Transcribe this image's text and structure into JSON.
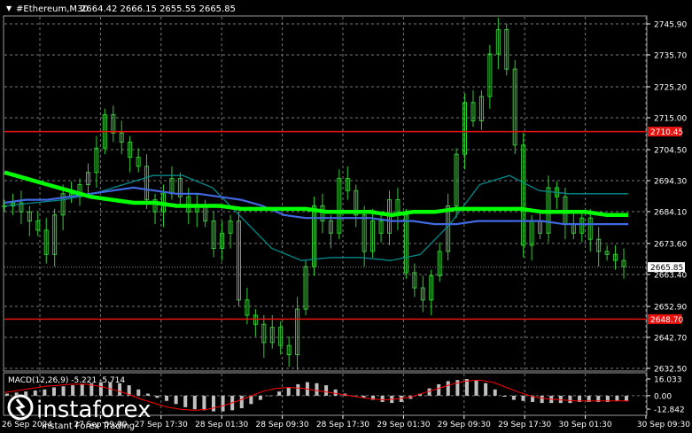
{
  "header": {
    "symbol": "#Ethereum,M30",
    "ohlc": "2664.42 2666.15 2655.55 2665.85"
  },
  "price_axis_ticks": [
    "2745.90",
    "2735.70",
    "2725.20",
    "2715.00",
    "2704.50",
    "2694.30",
    "2684.10",
    "2673.60",
    "2663.40",
    "2652.90",
    "2642.70",
    "2632.50"
  ],
  "time_axis_ticks": [
    "26 Sep 2024",
    "27 Sep 09:00",
    "27 Sep 17:30",
    "28 Sep 01:30",
    "28 Sep 09:30",
    "28 Sep 17:30",
    "29 Sep 01:30",
    "29 Sep 09:30",
    "29 Sep 17:30",
    "30 Sep 01:30",
    "30 Sep 09:30"
  ],
  "levels": {
    "resistance": {
      "value": 2710.45,
      "label": "2710.45",
      "color": "#e8130f"
    },
    "support": {
      "value": 2648.7,
      "label": "2648.70",
      "color": "#e8130f"
    },
    "current": {
      "value": 2665.85,
      "label": "2665.85"
    }
  },
  "macd": {
    "label": "MACD(12,26,9) -5.221 -5.714",
    "ticks": [
      "16.033",
      "0.00",
      "-12.842"
    ]
  },
  "watermark": {
    "brand": "instaforex",
    "tagline": "Instant Forex Trading"
  },
  "colors": {
    "candles": "#32cd32",
    "ma_slow": "#00ff00",
    "ma_mid": "#4169e1",
    "ma_fast": "#008b8b",
    "macd_hist": "#c0c0c0",
    "macd_signal": "#ff0000",
    "levels": "#e8130f"
  },
  "chart_data": {
    "type": "candlestick",
    "symbol": "#Ethereum",
    "timeframe": "M30",
    "y_axis": {
      "min": 2632.5,
      "max": 2745.9
    },
    "close_series": [
      2686,
      2687,
      2684,
      2681,
      2678,
      2670,
      2683,
      2690,
      2689,
      2693,
      2697,
      2705,
      2716,
      2710,
      2707,
      2702,
      2699,
      2688,
      2684,
      2690,
      2695,
      2689,
      2684,
      2686,
      2681,
      2672,
      2677,
      2681,
      2655,
      2650,
      2647,
      2641,
      2646,
      2640,
      2637,
      2652,
      2666,
      2686,
      2681,
      2677,
      2695,
      2691,
      2683,
      2671,
      2681,
      2677,
      2688,
      2683,
      2664,
      2659,
      2655,
      2663,
      2671,
      2686,
      2703,
      2720,
      2714,
      2722,
      2736,
      2744,
      2731,
      2706,
      2673,
      2681,
      2677,
      2692,
      2689,
      2680,
      2677,
      2682,
      2675,
      2671,
      2670,
      2668,
      2666
    ],
    "ma_slow_series": [
      2697,
      2695,
      2693,
      2691,
      2689,
      2688,
      2687,
      2687,
      2686,
      2686,
      2686,
      2685,
      2685,
      2685,
      2685,
      2684,
      2684,
      2684,
      2683,
      2684,
      2684,
      2685,
      2685,
      2685,
      2685,
      2684,
      2684,
      2684,
      2683,
      2683
    ],
    "ma_mid_series": [
      2687,
      2688,
      2688,
      2689,
      2690,
      2691,
      2692,
      2691,
      2690,
      2690,
      2689,
      2688,
      2686,
      2683,
      2682,
      2682,
      2682,
      2682,
      2681,
      2681,
      2680,
      2680,
      2681,
      2681,
      2681,
      2681,
      2680,
      2680,
      2680,
      2680
    ],
    "ma_fast_series": [
      2686,
      2687,
      2688,
      2690,
      2693,
      2696,
      2696,
      2692,
      2682,
      2672,
      2668,
      2669,
      2669,
      2668,
      2670,
      2680,
      2693,
      2696,
      2691,
      2690,
      2690,
      2690
    ],
    "macd_histogram": [
      2,
      3,
      4,
      5,
      6,
      8,
      9,
      10,
      11,
      12,
      13,
      13,
      12,
      10,
      6,
      2,
      -2,
      -5,
      -8,
      -11,
      -13,
      -14,
      -15,
      -15,
      -14,
      -12,
      -8,
      -4,
      0,
      4,
      8,
      11,
      13,
      12,
      10,
      6,
      2,
      0,
      -2,
      -4,
      -6,
      -7,
      -6,
      -3,
      2,
      7,
      11,
      14,
      15,
      16,
      15,
      12,
      6,
      -1,
      -4,
      -5,
      -6,
      -7,
      -7,
      -7,
      -7,
      -6,
      -6,
      -6,
      -6,
      -5,
      -5
    ],
    "macd_signal_series": [
      3,
      5,
      7,
      9,
      10,
      11,
      11,
      9,
      6,
      2,
      -3,
      -7,
      -11,
      -13,
      -14,
      -13,
      -10,
      -6,
      -1,
      4,
      7,
      8,
      7,
      5,
      3,
      1,
      -1,
      -3,
      -4,
      -3,
      -1,
      3,
      7,
      11,
      14,
      15,
      13,
      8,
      3,
      -1,
      -3,
      -4,
      -5,
      -5,
      -5,
      -5,
      -5
    ]
  }
}
